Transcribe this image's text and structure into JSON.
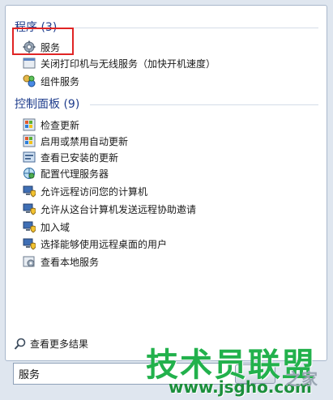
{
  "programs": {
    "header": "程序 (3)",
    "items": [
      {
        "label": "服务",
        "icon": "gear-icon"
      },
      {
        "label": "关闭打印机与无线服务（加快开机速度）",
        "icon": "program-icon"
      },
      {
        "label": "组件服务",
        "icon": "component-services-icon"
      }
    ]
  },
  "control_panel": {
    "header": "控制面板 (9)",
    "items": [
      {
        "label": "检查更新",
        "icon": "windows-update-icon"
      },
      {
        "label": "启用或禁用自动更新",
        "icon": "windows-update-icon"
      },
      {
        "label": "查看已安装的更新",
        "icon": "installed-updates-icon"
      },
      {
        "label": "配置代理服务器",
        "icon": "network-icon"
      },
      {
        "label": "允许远程访问您的计算机",
        "icon": "computer-shield-icon"
      },
      {
        "label": "允许从这台计算机发送远程协助邀请",
        "icon": "computer-shield-icon"
      },
      {
        "label": "加入域",
        "icon": "computer-shield-icon"
      },
      {
        "label": "选择能够使用远程桌面的用户",
        "icon": "computer-shield-icon"
      },
      {
        "label": "查看本地服务",
        "icon": "services-icon"
      }
    ]
  },
  "see_more": "查看更多结果",
  "search": {
    "value": "服务",
    "clear": "×"
  },
  "watermark": {
    "brand": "技术员联盟",
    "url": "www.jsgho.com",
    "side": "之家"
  },
  "colors": {
    "header": "#1e3c8c",
    "highlight": "#e02424",
    "watermark": "#22b14c"
  }
}
